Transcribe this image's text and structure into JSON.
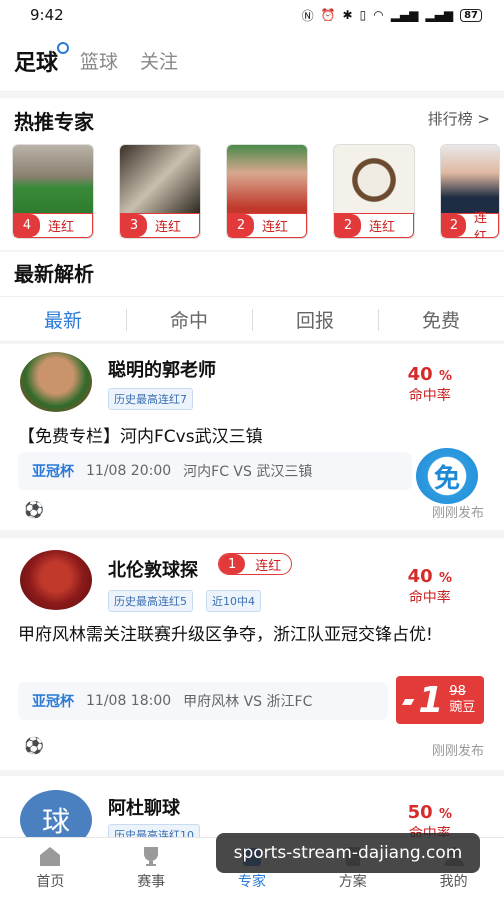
{
  "status": {
    "time": "9:42",
    "battery": "87"
  },
  "top_tabs": [
    {
      "label": "足球"
    },
    {
      "label": "篮球"
    },
    {
      "label": "关注"
    }
  ],
  "hot": {
    "title": "热推专家",
    "rank_label": "排行榜 >",
    "experts": [
      {
        "count": "4",
        "label": "连红"
      },
      {
        "count": "3",
        "label": "连红"
      },
      {
        "count": "2",
        "label": "连红"
      },
      {
        "count": "2",
        "label": "连红"
      },
      {
        "count": "2",
        "label": "连红"
      }
    ]
  },
  "latest_title": "最新解析",
  "filter_tabs": [
    {
      "label": "最新"
    },
    {
      "label": "命中"
    },
    {
      "label": "回报"
    },
    {
      "label": "免费"
    }
  ],
  "cards": [
    {
      "name": "聪明的郭老师",
      "chips": [
        "历史最高连红7"
      ],
      "rate": "40",
      "rate_unit": "%",
      "rate_label": "命中率",
      "title": "【免费专栏】河内FCvs武汉三镇",
      "league": "亚冠杯",
      "time": "11/08 20:00",
      "match": "河内FC VS 武汉三镇",
      "badge": "免",
      "posted": "刚刚发布"
    },
    {
      "name": "北伦敦球探",
      "streak_count": "1",
      "streak_label": "连红",
      "chips": [
        "历史最高连红5",
        "近10中4"
      ],
      "rate": "40",
      "rate_unit": "%",
      "rate_label": "命中率",
      "title": "甲府风林需关注联赛升级区争夺，浙江队亚冠交锋占优!",
      "league": "亚冠杯",
      "time": "11/08 18:00",
      "match": "甲府风林 VS 浙江FC",
      "price_big": "1",
      "price_old": "98",
      "price_unit": "豌豆",
      "posted": "刚刚发布"
    },
    {
      "name": "阿杜聊球",
      "avatar_char": "球",
      "chips": [
        "历史最高连红10"
      ],
      "rate": "50",
      "rate_unit": "%",
      "rate_label": "命中率"
    }
  ],
  "bottom_nav": [
    {
      "label": "首页"
    },
    {
      "label": "赛事"
    },
    {
      "label": "专家"
    },
    {
      "label": "方案"
    },
    {
      "label": "我的"
    }
  ],
  "watermark": "sports-stream-dajiang.com",
  "colors": {
    "accent": "#2a7ad6",
    "red": "#e23a3a"
  }
}
